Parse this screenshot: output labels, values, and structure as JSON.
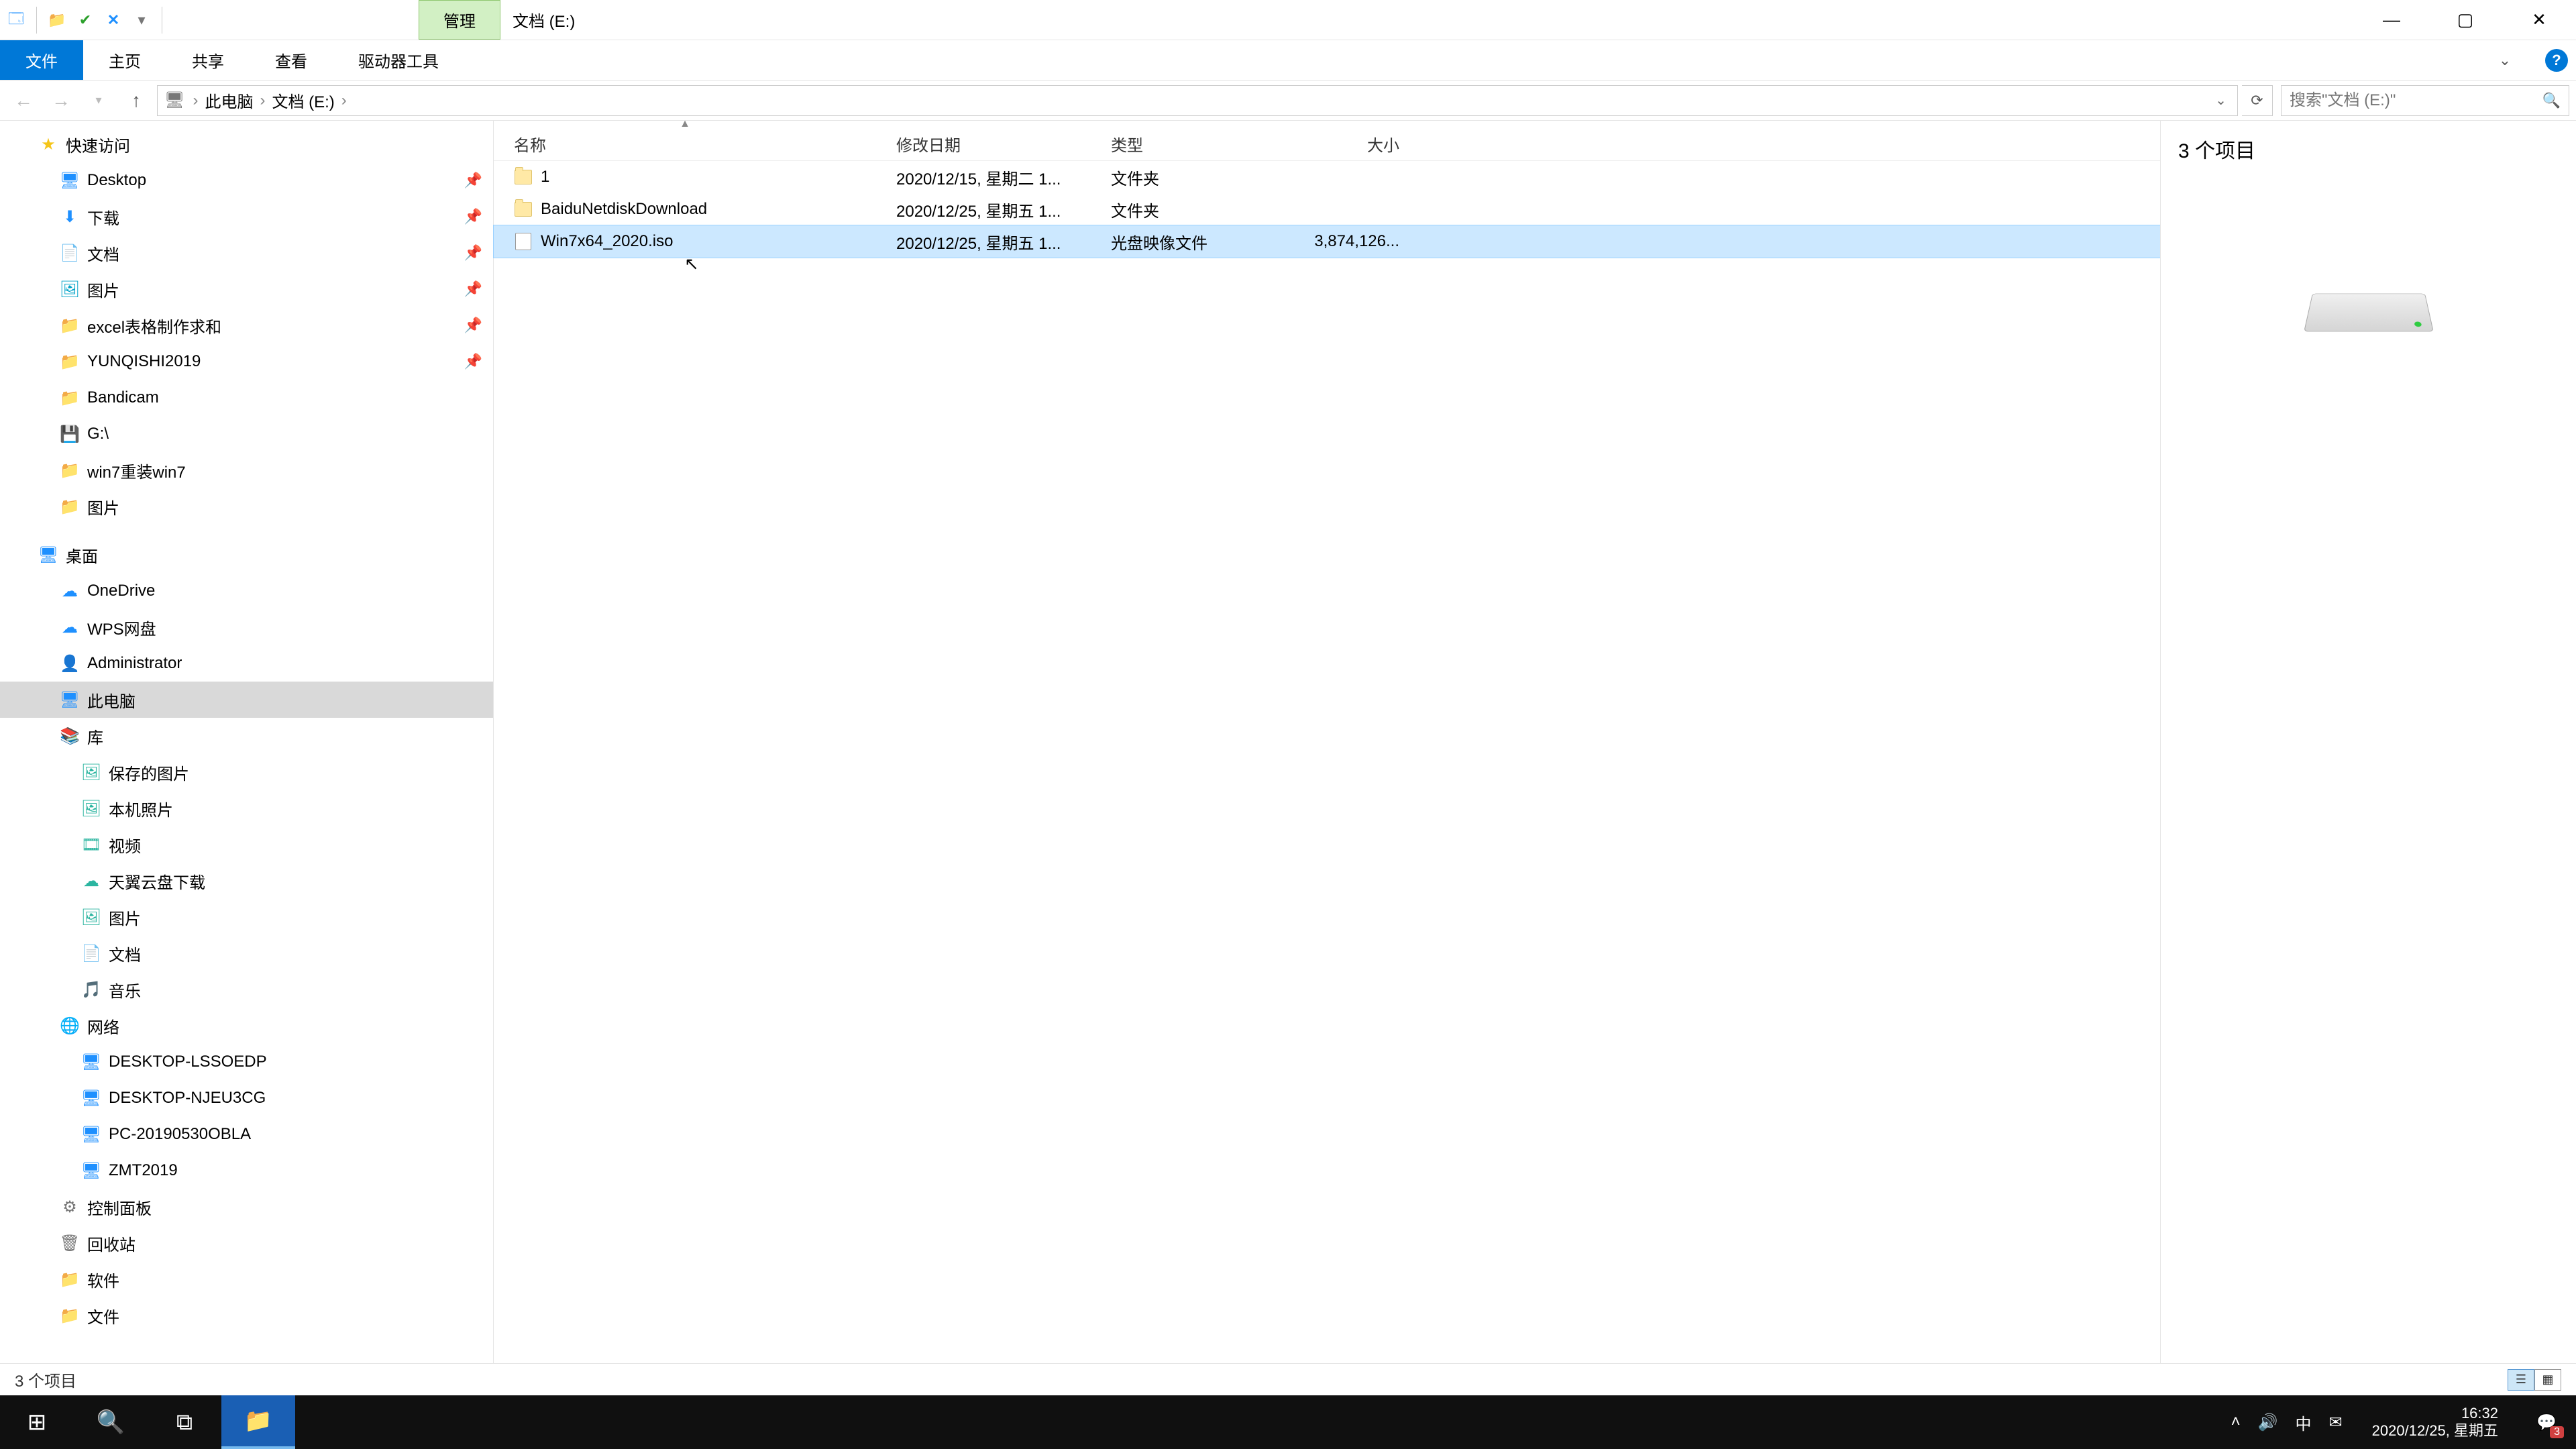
{
  "title": {
    "contextual_tab": "管理",
    "location_label": "文档 (E:)"
  },
  "ribbon": {
    "file": "文件",
    "home": "主页",
    "share": "共享",
    "view": "查看",
    "drive_tools": "驱动器工具"
  },
  "breadcrumb": {
    "root": "此电脑",
    "loc": "文档 (E:)"
  },
  "search": {
    "placeholder": "搜索\"文档 (E:)\""
  },
  "columns": {
    "name": "名称",
    "date": "修改日期",
    "type": "类型",
    "size": "大小"
  },
  "rows": [
    {
      "name": "1",
      "date": "2020/12/15, 星期二 1...",
      "type": "文件夹",
      "size": "",
      "kind": "folder",
      "selected": false
    },
    {
      "name": "BaiduNetdiskDownload",
      "date": "2020/12/25, 星期五 1...",
      "type": "文件夹",
      "size": "",
      "kind": "folder",
      "selected": false
    },
    {
      "name": "Win7x64_2020.iso",
      "date": "2020/12/25, 星期五 1...",
      "type": "光盘映像文件",
      "size": "3,874,126...",
      "kind": "iso",
      "selected": true
    }
  ],
  "sidebar": {
    "quick_access": "快速访问",
    "qa": [
      {
        "label": "Desktop",
        "icon": "🖥",
        "cls": "c-blue"
      },
      {
        "label": "下载",
        "icon": "⬇",
        "cls": "c-blue"
      },
      {
        "label": "文档",
        "icon": "📄",
        "cls": "c-teal"
      },
      {
        "label": "图片",
        "icon": "🖼",
        "cls": "c-cyan"
      },
      {
        "label": "excel表格制作求和",
        "icon": "📁",
        "cls": "c-yellow"
      },
      {
        "label": "YUNQISHI2019",
        "icon": "📁",
        "cls": "c-yellow"
      },
      {
        "label": "Bandicam",
        "icon": "📁",
        "cls": "c-yellow"
      },
      {
        "label": "G:\\",
        "icon": "💾",
        "cls": "c-blue"
      },
      {
        "label": "win7重装win7",
        "icon": "📁",
        "cls": "c-yellow"
      },
      {
        "label": "图片",
        "icon": "📁",
        "cls": "c-yellow"
      }
    ],
    "desktop": "桌面",
    "onedrive": "OneDrive",
    "wps": "WPS网盘",
    "admin": "Administrator",
    "thispc": "此电脑",
    "lib": "库",
    "libs": [
      {
        "label": "保存的图片",
        "icon": "🖼"
      },
      {
        "label": "本机照片",
        "icon": "🖼"
      },
      {
        "label": "视频",
        "icon": "🎞"
      },
      {
        "label": "天翼云盘下载",
        "icon": "☁"
      },
      {
        "label": "图片",
        "icon": "🖼"
      },
      {
        "label": "文档",
        "icon": "📄"
      },
      {
        "label": "音乐",
        "icon": "🎵"
      }
    ],
    "network": "网络",
    "hosts": [
      "DESKTOP-LSSOEDP",
      "DESKTOP-NJEU3CG",
      "PC-20190530OBLA",
      "ZMT2019"
    ],
    "control_panel": "控制面板",
    "recycle": "回收站",
    "software": "软件",
    "docs": "文件"
  },
  "preview": {
    "summary": "3 个项目"
  },
  "status": {
    "text": "3 个项目"
  },
  "taskbar": {
    "time": "16:32",
    "date": "2020/12/25, 星期五",
    "ime": "中",
    "notif_count": "3"
  }
}
